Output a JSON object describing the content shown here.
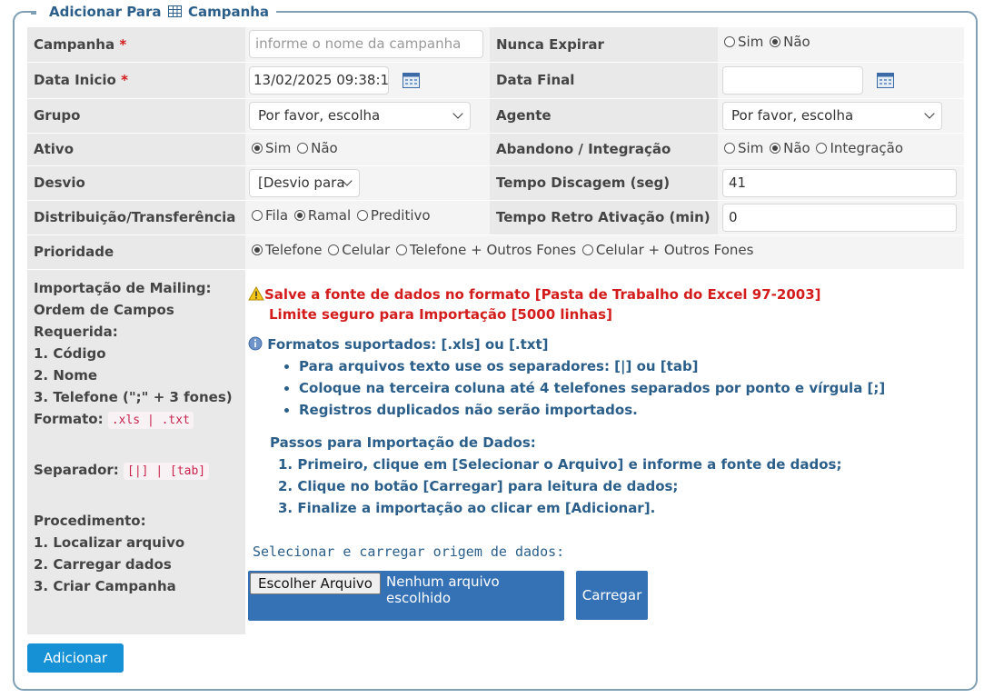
{
  "fieldset": {
    "legend_prefix": "Adicionar Para",
    "legend_icon": "table-grid-icon",
    "legend_suffix": "Campanha"
  },
  "fields": {
    "campanha": {
      "label": "Campanha",
      "required_mark": "*",
      "placeholder": "informe o nome da campanha",
      "value": ""
    },
    "nunca_expirar": {
      "label": "Nunca Expirar",
      "options": [
        "Sim",
        "Não"
      ],
      "selected": "Não"
    },
    "data_inicio": {
      "label": "Data Inicio",
      "required_mark": "*",
      "value": "13/02/2025 09:38:1",
      "icon": "calendar-icon"
    },
    "data_final": {
      "label": "Data Final",
      "value": "",
      "icon": "calendar-icon"
    },
    "grupo": {
      "label": "Grupo",
      "selected": "Por favor, escolha"
    },
    "agente": {
      "label": "Agente",
      "selected": "Por favor, escolha"
    },
    "ativo": {
      "label": "Ativo",
      "options": [
        "Sim",
        "Não"
      ],
      "selected": "Sim"
    },
    "abandono": {
      "label": "Abandono / Integração",
      "options": [
        "Sim",
        "Não",
        "Integração"
      ],
      "selected": "Não"
    },
    "desvio": {
      "label": "Desvio",
      "selected": "[Desvio para"
    },
    "tempo_discagem": {
      "label": "Tempo Discagem (seg)",
      "value": "41"
    },
    "distribuicao": {
      "label": "Distribuição/Transferência",
      "options": [
        "Fila",
        "Ramal",
        "Preditivo"
      ],
      "selected": "Ramal"
    },
    "tempo_retro": {
      "label": "Tempo Retro Ativação (min)",
      "value": "0"
    },
    "prioridade": {
      "label": "Prioridade",
      "options": [
        "Telefone",
        "Celular",
        "Telefone + Outros Fones",
        "Celular + Outros Fones"
      ],
      "selected": "Telefone"
    }
  },
  "import": {
    "left": {
      "title_lines": [
        "Importação de Mailing:",
        "Ordem de Campos",
        "Requerida:"
      ],
      "fields": [
        "1. Código",
        "2. Nome",
        "3. Telefone (\";\" + 3 fones)"
      ],
      "formato_label": "Formato:",
      "formato_code": ".xls | .txt",
      "separador_label": "Separador:",
      "separador_code": "[|] | [tab]",
      "procedimento_title": "Procedimento:",
      "procedimento": [
        "1. Localizar arquivo",
        "2. Carregar dados",
        "3. Criar Campanha"
      ]
    },
    "warning": {
      "icon": "warning-icon",
      "line1": "Salve a fonte de dados no formato [Pasta de Trabalho do Excel 97-2003]",
      "line2": "Limite seguro para Importação [5000 linhas]"
    },
    "info": {
      "icon": "info-icon",
      "title": "Formatos suportados: [.xls] ou [.txt]",
      "bullets": [
        "Para arquivos texto use os separadores: [|] ou [tab]",
        "Coloque na terceira coluna até 4 telefones separados por ponto e vírgula [;]",
        "Registros duplicados não serão importados."
      ]
    },
    "steps": {
      "title": "Passos para Importação de Dados:",
      "items": [
        "1. Primeiro, clique em [Selecionar o Arquivo] e informe a fonte de dados;",
        "2. Clique no botão [Carregar] para leitura de dados;",
        "3. Finalize a importação ao clicar em [Adicionar]."
      ]
    },
    "upload_label": "Selecionar e carregar origem de dados:",
    "file_button": "Escolher Arquivo",
    "file_name": "Nenhum arquivo escolhido",
    "load_button": "Carregar"
  },
  "add_button": "Adicionar",
  "colors": {
    "accent": "#3572b5",
    "add_button": "#1691d6",
    "legend": "#2b5f8a",
    "warning": "#d31c1c"
  }
}
